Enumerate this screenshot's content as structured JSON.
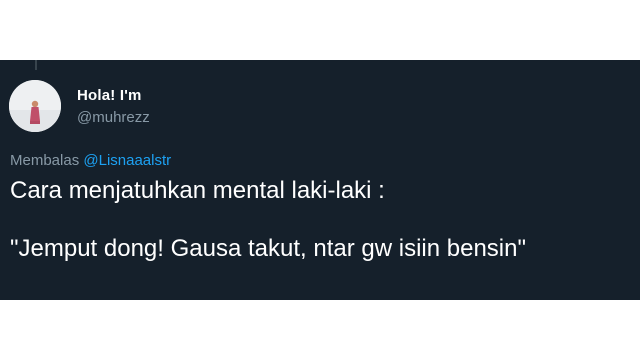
{
  "tweet": {
    "display_name": "Hola! I'm",
    "handle": "@muhrezz",
    "avatar": {
      "icon": "profile-photo-icon"
    },
    "reply": {
      "prefix": "Membalas",
      "mention": "@Lisnaaalstr"
    },
    "text_lines": [
      "Cara menjatuhkan mental laki-laki :",
      "\"Jemput dong! Gausa takut, ntar gw isiin bensin\""
    ]
  },
  "colors": {
    "card_background": "#15202b",
    "page_background": "#ffffff",
    "primary_text": "#ffffff",
    "secondary_text": "#8899a6",
    "mention": "#1da1f2",
    "thread_line": "#38444d"
  }
}
